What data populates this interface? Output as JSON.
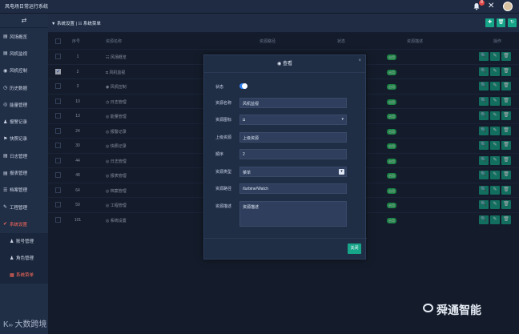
{
  "app": {
    "title": "风电场日常运行系统"
  },
  "topbar": {
    "bell_count": "8"
  },
  "sidebar": {
    "items": [
      {
        "icon": "▤",
        "label": "风场概览"
      },
      {
        "icon": "▤",
        "label": "风机监视"
      },
      {
        "icon": "◉",
        "label": "风机控制"
      },
      {
        "icon": "◷",
        "label": "历史数据"
      },
      {
        "icon": "◎",
        "label": "能量管理"
      },
      {
        "icon": "♟",
        "label": "报警记录"
      },
      {
        "icon": "⚑",
        "label": "快照记录"
      },
      {
        "icon": "▤",
        "label": "日志管理"
      },
      {
        "icon": "▤",
        "label": "报表管理"
      },
      {
        "icon": "☰",
        "label": "档案管理"
      },
      {
        "icon": "✎",
        "label": "工程管理"
      },
      {
        "icon": "✔",
        "label": "系统设置"
      }
    ],
    "subitems": [
      {
        "icon": "♟",
        "label": "账号管理"
      },
      {
        "icon": "♟",
        "label": "角色管理"
      },
      {
        "icon": "▦",
        "label": "系统菜单"
      }
    ]
  },
  "breadcrumb": {
    "text": "▼ 系统设置 | ☷ 系统菜单"
  },
  "table": {
    "headers": {
      "no": "序号",
      "name": "资源名称",
      "path": "资源路径",
      "status": "状态",
      "desc": "资源描述",
      "ops": "操作"
    },
    "rows": [
      {
        "no": "1",
        "name": "☷ 风场概览",
        "badge": "启用"
      },
      {
        "no": "2",
        "name": "◘ 风机监视",
        "badge": "启用"
      },
      {
        "no": "3",
        "name": "◉ 风机控制",
        "badge": "启用"
      },
      {
        "no": "10",
        "name": "◷ 日志管理",
        "badge": "启用"
      },
      {
        "no": "13",
        "name": "◎ 能量管理",
        "badge": "启用"
      },
      {
        "no": "24",
        "name": "◎ 报警记录",
        "badge": "启用"
      },
      {
        "no": "30",
        "name": "◎ 快照记录",
        "badge": "启用"
      },
      {
        "no": "44",
        "name": "◎ 日志管理",
        "badge": "启用"
      },
      {
        "no": "48",
        "name": "◎ 报表管理",
        "badge": "启用"
      },
      {
        "no": "64",
        "name": "◎ 档案管理",
        "badge": "启用"
      },
      {
        "no": "59",
        "name": "◎ 工程管理",
        "badge": "启用"
      },
      {
        "no": "101",
        "name": "◎ 系统设置",
        "badge": "启用"
      }
    ]
  },
  "modal": {
    "title": "◉ 查看",
    "fields": {
      "status_label": "状态",
      "name_label": "资源名称",
      "name_value": "风机监视",
      "icon_label": "资源图标",
      "icon_value": "◘",
      "parent_label": "上级资源",
      "parent_value": "上级资源",
      "order_label": "顺序",
      "order_value": "2",
      "type_label": "资源类型",
      "type_value": "菜单",
      "path_label": "资源路径",
      "path_value": "/turbine/Watch",
      "desc_label": "资源描述",
      "desc_value": "资源描述"
    },
    "close_label": "关闭"
  },
  "watermarks": {
    "left": "大数跨境",
    "right": "舜通智能"
  },
  "colors": {
    "accent": "#17a589",
    "badge_green": "#22c55e",
    "active_red": "#ff6b5a",
    "bg": "#1b2538"
  }
}
